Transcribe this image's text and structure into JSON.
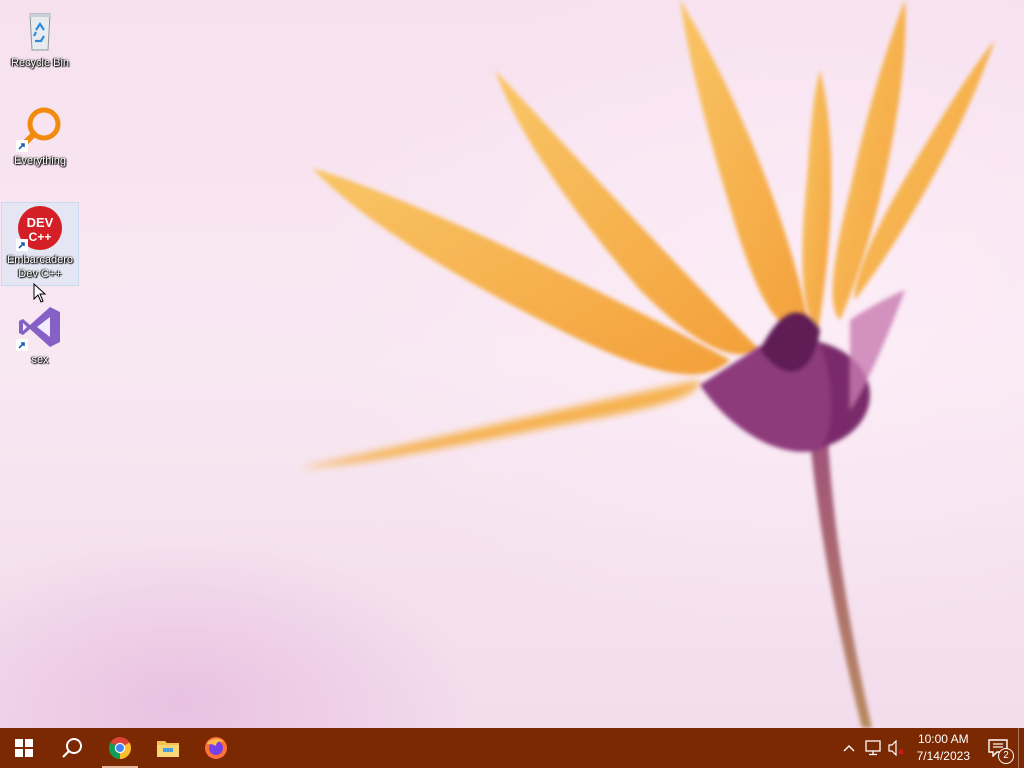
{
  "desktop": {
    "icons": [
      {
        "label": "Recycle Bin",
        "icon": "recycle-bin-icon"
      },
      {
        "label": "Everything",
        "icon": "everything-search-icon"
      },
      {
        "label": "Embarcadero Dev C++",
        "icon": "dev-cpp-icon",
        "glyph_text_top": "DEV",
        "glyph_text_bottom": "C++"
      },
      {
        "label": "sex",
        "icon": "visual-studio-icon"
      }
    ]
  },
  "taskbar": {
    "start": "windows-start-icon",
    "search": "search-icon",
    "pinned": [
      {
        "name": "chrome",
        "icon": "chrome-icon"
      },
      {
        "name": "file-explorer",
        "icon": "folder-icon"
      },
      {
        "name": "firefox",
        "icon": "firefox-icon"
      }
    ],
    "tray": {
      "time": "10:00 AM",
      "date": "7/14/2023",
      "notification_count": "2"
    }
  },
  "colors": {
    "taskbar": "#7a2902",
    "petal": "#f6b13e",
    "flower_center": "#7a2a6a"
  }
}
